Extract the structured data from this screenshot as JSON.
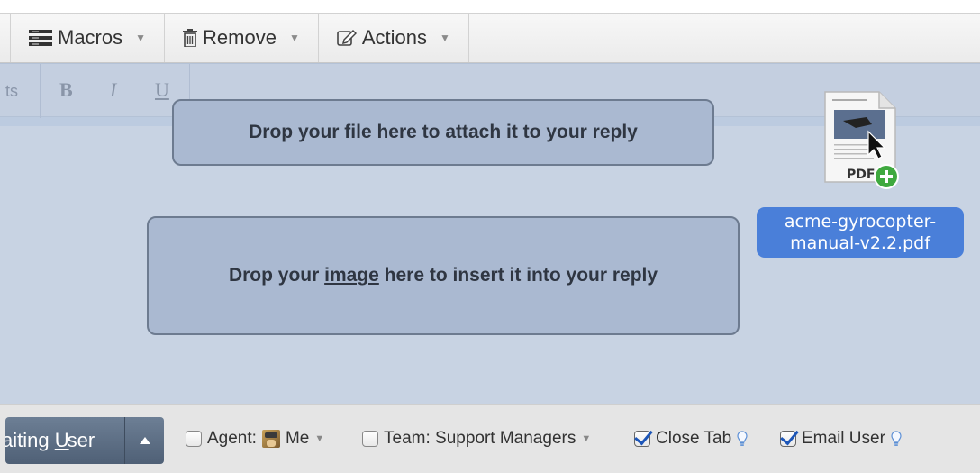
{
  "toolbar": {
    "macros_label": "Macros",
    "remove_label": "Remove",
    "actions_label": "Actions"
  },
  "editor": {
    "format_ts": "ts",
    "bold": "B",
    "italic": "I",
    "underline": "U",
    "drop_file_text": "Drop your file here to attach it to your reply",
    "drop_image_before": "Drop your ",
    "drop_image_link": "image",
    "drop_image_after": " here to insert it into your reply"
  },
  "dragged_file": {
    "name_line1": "acme-gyrocopter-",
    "name_line2": "manual-v2.2.pdf",
    "icon_label": "PDF"
  },
  "bottom": {
    "send_label_a": "aiting ",
    "send_label_u": "U",
    "send_label_b": "ser",
    "agent_label": "Agent:",
    "agent_value": "Me",
    "team_label": "Team: Support Managers",
    "close_tab_label": "Close Tab",
    "email_user_label": "Email User"
  },
  "colors": {
    "toolbar_bg": "#ebebeb",
    "editor_bg": "#c8d3e3",
    "drop_zone_bg": "#aab9d1",
    "file_label_bg": "#4a7fd9",
    "send_button": "#5a6b80",
    "checkbox_check": "#1d56b8"
  }
}
